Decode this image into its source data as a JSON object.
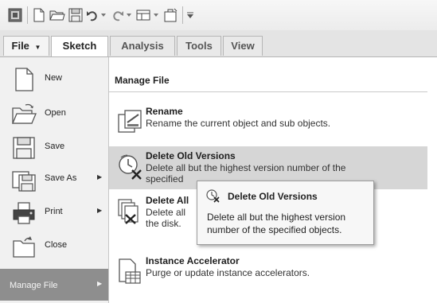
{
  "quick_access_toolbar": {
    "icons": [
      "app-menu-icon",
      "new-file-icon",
      "open-folder-icon",
      "save-icon",
      "undo-icon",
      "redo-icon",
      "rebuild-icon",
      "clipboard-icon",
      "customize-icon"
    ]
  },
  "tabs": [
    {
      "label": "File",
      "active": false
    },
    {
      "label": "Sketch",
      "active": true
    },
    {
      "label": "Analysis",
      "active": false
    },
    {
      "label": "Tools",
      "active": false
    },
    {
      "label": "View",
      "active": false
    }
  ],
  "file_menu": {
    "items": [
      {
        "label": "New",
        "icon": "new-document-icon",
        "submenu": false
      },
      {
        "label": "Open",
        "icon": "open-folder-icon",
        "submenu": false
      },
      {
        "label": "Save",
        "icon": "save-disk-icon",
        "submenu": false
      },
      {
        "label": "Save As",
        "icon": "save-as-icon",
        "submenu": true
      },
      {
        "label": "Print",
        "icon": "printer-icon",
        "submenu": true
      },
      {
        "label": "Close",
        "icon": "close-folder-icon",
        "submenu": false
      }
    ],
    "selected": {
      "label": "Manage File",
      "submenu": true
    }
  },
  "manage_file": {
    "header": "Manage File",
    "items": [
      {
        "title": "Rename",
        "description": "Rename the current object and sub objects.",
        "icon": "rename-icon"
      },
      {
        "title": "Delete Old Versions",
        "description": "Delete all but the highest version number of the",
        "description_cont": "specified",
        "icon": "delete-old-versions-icon",
        "highlighted": true
      },
      {
        "title": "Delete All",
        "description": "Delete all",
        "description_cont": "the disk.",
        "icon": "delete-all-icon"
      },
      {
        "title": "Instance Accelerator",
        "description": "Purge or update instance accelerators.",
        "icon": "instance-accelerator-icon"
      }
    ]
  },
  "tooltip": {
    "title": "Delete Old Versions",
    "description": "Delete all but the highest version number of the specified objects.",
    "icon": "delete-old-versions-icon"
  },
  "colors": {
    "highlight": "#d6d6d6",
    "selected_menu": "#8e8e8e",
    "menu_bg": "#f1f1f1"
  }
}
